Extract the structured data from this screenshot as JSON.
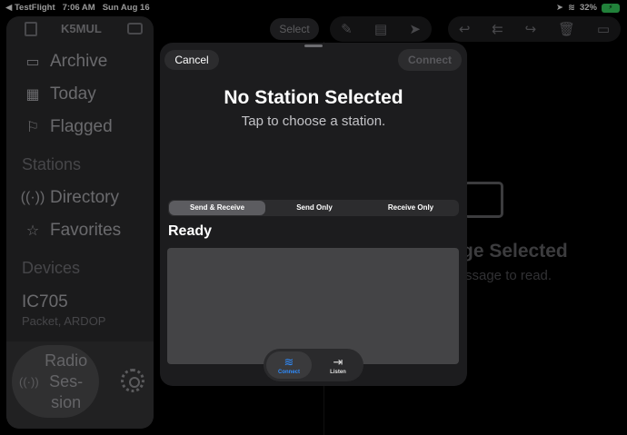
{
  "status_bar": {
    "back_app": "◀ TestFlight",
    "time": "7:06 AM",
    "date": "Sun Aug 16",
    "battery": "32%"
  },
  "sidebar": {
    "title": "K5MUL",
    "items": [
      {
        "label": "Archive",
        "icon": "archive-box-icon"
      },
      {
        "label": "Today",
        "icon": "calendar-icon"
      },
      {
        "label": "Flagged",
        "icon": "flag-icon"
      }
    ],
    "stations_header": "Stations",
    "station_items": [
      {
        "label": "Directory",
        "icon": "antenna-icon"
      },
      {
        "label": "Favorites",
        "icon": "star-icon"
      }
    ],
    "devices_header": "Devices",
    "device": {
      "name": "IC705",
      "detail": "Packet, ARDOP"
    },
    "radio_session_label": "Radio Ses-sion"
  },
  "toolbar": {
    "select_label": "Select"
  },
  "detail": {
    "empty_title": "ge Selected",
    "empty_subtitle": "ssage to read."
  },
  "sheet": {
    "cancel_label": "Cancel",
    "connect_label": "Connect",
    "title": "No Station Selected",
    "subtitle": "Tap to choose a station.",
    "segments": [
      "Send & Receive",
      "Send Only",
      "Receive Only"
    ],
    "selected_segment": "Send & Receive",
    "status": "Ready",
    "modes": [
      {
        "label": "Connect",
        "icon": "wifi-icon",
        "active": true
      },
      {
        "label": "Listen",
        "icon": "enter-icon",
        "active": false
      }
    ]
  },
  "colors": {
    "accent": "#2e8cff",
    "battery": "#34c759"
  }
}
